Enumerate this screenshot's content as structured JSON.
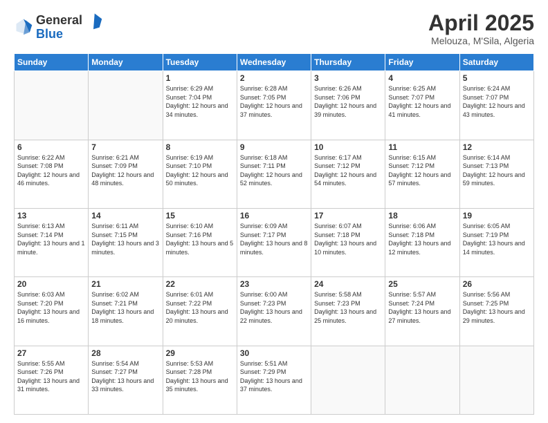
{
  "logo": {
    "general": "General",
    "blue": "Blue"
  },
  "header": {
    "title": "April 2025",
    "subtitle": "Melouza, M'Sila, Algeria"
  },
  "weekdays": [
    "Sunday",
    "Monday",
    "Tuesday",
    "Wednesday",
    "Thursday",
    "Friday",
    "Saturday"
  ],
  "weeks": [
    [
      {
        "day": "",
        "sunrise": "",
        "sunset": "",
        "daylight": ""
      },
      {
        "day": "",
        "sunrise": "",
        "sunset": "",
        "daylight": ""
      },
      {
        "day": "1",
        "sunrise": "Sunrise: 6:29 AM",
        "sunset": "Sunset: 7:04 PM",
        "daylight": "Daylight: 12 hours and 34 minutes."
      },
      {
        "day": "2",
        "sunrise": "Sunrise: 6:28 AM",
        "sunset": "Sunset: 7:05 PM",
        "daylight": "Daylight: 12 hours and 37 minutes."
      },
      {
        "day": "3",
        "sunrise": "Sunrise: 6:26 AM",
        "sunset": "Sunset: 7:06 PM",
        "daylight": "Daylight: 12 hours and 39 minutes."
      },
      {
        "day": "4",
        "sunrise": "Sunrise: 6:25 AM",
        "sunset": "Sunset: 7:07 PM",
        "daylight": "Daylight: 12 hours and 41 minutes."
      },
      {
        "day": "5",
        "sunrise": "Sunrise: 6:24 AM",
        "sunset": "Sunset: 7:07 PM",
        "daylight": "Daylight: 12 hours and 43 minutes."
      }
    ],
    [
      {
        "day": "6",
        "sunrise": "Sunrise: 6:22 AM",
        "sunset": "Sunset: 7:08 PM",
        "daylight": "Daylight: 12 hours and 46 minutes."
      },
      {
        "day": "7",
        "sunrise": "Sunrise: 6:21 AM",
        "sunset": "Sunset: 7:09 PM",
        "daylight": "Daylight: 12 hours and 48 minutes."
      },
      {
        "day": "8",
        "sunrise": "Sunrise: 6:19 AM",
        "sunset": "Sunset: 7:10 PM",
        "daylight": "Daylight: 12 hours and 50 minutes."
      },
      {
        "day": "9",
        "sunrise": "Sunrise: 6:18 AM",
        "sunset": "Sunset: 7:11 PM",
        "daylight": "Daylight: 12 hours and 52 minutes."
      },
      {
        "day": "10",
        "sunrise": "Sunrise: 6:17 AM",
        "sunset": "Sunset: 7:12 PM",
        "daylight": "Daylight: 12 hours and 54 minutes."
      },
      {
        "day": "11",
        "sunrise": "Sunrise: 6:15 AM",
        "sunset": "Sunset: 7:12 PM",
        "daylight": "Daylight: 12 hours and 57 minutes."
      },
      {
        "day": "12",
        "sunrise": "Sunrise: 6:14 AM",
        "sunset": "Sunset: 7:13 PM",
        "daylight": "Daylight: 12 hours and 59 minutes."
      }
    ],
    [
      {
        "day": "13",
        "sunrise": "Sunrise: 6:13 AM",
        "sunset": "Sunset: 7:14 PM",
        "daylight": "Daylight: 13 hours and 1 minute."
      },
      {
        "day": "14",
        "sunrise": "Sunrise: 6:11 AM",
        "sunset": "Sunset: 7:15 PM",
        "daylight": "Daylight: 13 hours and 3 minutes."
      },
      {
        "day": "15",
        "sunrise": "Sunrise: 6:10 AM",
        "sunset": "Sunset: 7:16 PM",
        "daylight": "Daylight: 13 hours and 5 minutes."
      },
      {
        "day": "16",
        "sunrise": "Sunrise: 6:09 AM",
        "sunset": "Sunset: 7:17 PM",
        "daylight": "Daylight: 13 hours and 8 minutes."
      },
      {
        "day": "17",
        "sunrise": "Sunrise: 6:07 AM",
        "sunset": "Sunset: 7:18 PM",
        "daylight": "Daylight: 13 hours and 10 minutes."
      },
      {
        "day": "18",
        "sunrise": "Sunrise: 6:06 AM",
        "sunset": "Sunset: 7:18 PM",
        "daylight": "Daylight: 13 hours and 12 minutes."
      },
      {
        "day": "19",
        "sunrise": "Sunrise: 6:05 AM",
        "sunset": "Sunset: 7:19 PM",
        "daylight": "Daylight: 13 hours and 14 minutes."
      }
    ],
    [
      {
        "day": "20",
        "sunrise": "Sunrise: 6:03 AM",
        "sunset": "Sunset: 7:20 PM",
        "daylight": "Daylight: 13 hours and 16 minutes."
      },
      {
        "day": "21",
        "sunrise": "Sunrise: 6:02 AM",
        "sunset": "Sunset: 7:21 PM",
        "daylight": "Daylight: 13 hours and 18 minutes."
      },
      {
        "day": "22",
        "sunrise": "Sunrise: 6:01 AM",
        "sunset": "Sunset: 7:22 PM",
        "daylight": "Daylight: 13 hours and 20 minutes."
      },
      {
        "day": "23",
        "sunrise": "Sunrise: 6:00 AM",
        "sunset": "Sunset: 7:23 PM",
        "daylight": "Daylight: 13 hours and 22 minutes."
      },
      {
        "day": "24",
        "sunrise": "Sunrise: 5:58 AM",
        "sunset": "Sunset: 7:23 PM",
        "daylight": "Daylight: 13 hours and 25 minutes."
      },
      {
        "day": "25",
        "sunrise": "Sunrise: 5:57 AM",
        "sunset": "Sunset: 7:24 PM",
        "daylight": "Daylight: 13 hours and 27 minutes."
      },
      {
        "day": "26",
        "sunrise": "Sunrise: 5:56 AM",
        "sunset": "Sunset: 7:25 PM",
        "daylight": "Daylight: 13 hours and 29 minutes."
      }
    ],
    [
      {
        "day": "27",
        "sunrise": "Sunrise: 5:55 AM",
        "sunset": "Sunset: 7:26 PM",
        "daylight": "Daylight: 13 hours and 31 minutes."
      },
      {
        "day": "28",
        "sunrise": "Sunrise: 5:54 AM",
        "sunset": "Sunset: 7:27 PM",
        "daylight": "Daylight: 13 hours and 33 minutes."
      },
      {
        "day": "29",
        "sunrise": "Sunrise: 5:53 AM",
        "sunset": "Sunset: 7:28 PM",
        "daylight": "Daylight: 13 hours and 35 minutes."
      },
      {
        "day": "30",
        "sunrise": "Sunrise: 5:51 AM",
        "sunset": "Sunset: 7:29 PM",
        "daylight": "Daylight: 13 hours and 37 minutes."
      },
      {
        "day": "",
        "sunrise": "",
        "sunset": "",
        "daylight": ""
      },
      {
        "day": "",
        "sunrise": "",
        "sunset": "",
        "daylight": ""
      },
      {
        "day": "",
        "sunrise": "",
        "sunset": "",
        "daylight": ""
      }
    ]
  ]
}
